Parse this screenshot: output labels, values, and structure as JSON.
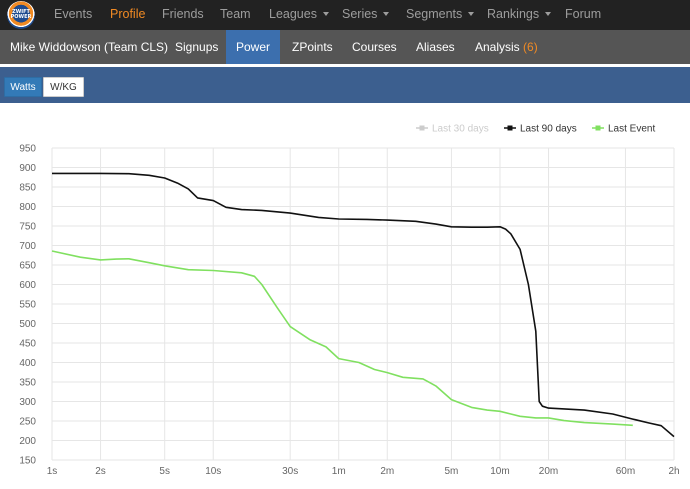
{
  "topnav": {
    "logo_text": "ZWIFT POWER",
    "items": [
      {
        "label": "Events",
        "dropdown": false
      },
      {
        "label": "Profile",
        "dropdown": false,
        "active": true
      },
      {
        "label": "Friends",
        "dropdown": false
      },
      {
        "label": "Team",
        "dropdown": false
      },
      {
        "label": "Leagues",
        "dropdown": true
      },
      {
        "label": "Series",
        "dropdown": true
      },
      {
        "label": "Segments",
        "dropdown": true
      },
      {
        "label": "Rankings",
        "dropdown": true
      },
      {
        "label": "Forum",
        "dropdown": false
      }
    ]
  },
  "subnav": {
    "profile_name": "Mike Widdowson (Team CLS)",
    "tabs": [
      {
        "label": "Signups"
      },
      {
        "label": "Power",
        "active": true
      },
      {
        "label": "ZPoints"
      },
      {
        "label": "Courses"
      },
      {
        "label": "Aliases"
      },
      {
        "label": "Analysis",
        "badge": "(6)"
      }
    ]
  },
  "power_toggle": {
    "watts": "Watts",
    "wkg": "W/KG",
    "selected": "Watts"
  },
  "chart_data": {
    "type": "line",
    "x_scale": "log",
    "x_tick_labels": [
      "1s",
      "2s",
      "5s",
      "10s",
      "30s",
      "1m",
      "2m",
      "5m",
      "10m",
      "20m",
      "60m",
      "2h"
    ],
    "x_tick_seconds": [
      1,
      2,
      5,
      10,
      30,
      60,
      120,
      300,
      600,
      1200,
      3600,
      7200
    ],
    "y_ticks": [
      150,
      200,
      250,
      300,
      350,
      400,
      450,
      500,
      550,
      600,
      650,
      700,
      750,
      800,
      850,
      900,
      950
    ],
    "ylim": [
      150,
      950
    ],
    "grid": true,
    "legend_position": "top-right",
    "series": [
      {
        "name": "Last 30 days",
        "color": "#cccccc",
        "hidden": true,
        "x": [],
        "y": []
      },
      {
        "name": "Last 90 days",
        "color": "#111111",
        "x": [
          1,
          2,
          3,
          4,
          5,
          6,
          7,
          8,
          10,
          12,
          15,
          20,
          30,
          45,
          60,
          90,
          120,
          180,
          240,
          300,
          400,
          500,
          600,
          650,
          700,
          800,
          900,
          1000,
          1050,
          1100,
          1200,
          1500,
          2000,
          3000,
          4000,
          5000,
          6000,
          7200
        ],
        "y": [
          885,
          885,
          884,
          880,
          873,
          860,
          845,
          822,
          815,
          798,
          792,
          790,
          783,
          772,
          768,
          767,
          765,
          762,
          755,
          748,
          747,
          747,
          748,
          742,
          730,
          690,
          600,
          480,
          300,
          288,
          283,
          281,
          278,
          268,
          255,
          245,
          238,
          210
        ]
      },
      {
        "name": "Last Event",
        "color": "#80e060",
        "x": [
          1,
          1.5,
          2,
          2.5,
          3,
          4,
          5,
          7,
          10,
          15,
          18,
          20,
          25,
          30,
          40,
          50,
          60,
          80,
          100,
          120,
          150,
          200,
          240,
          300,
          400,
          500,
          600,
          700,
          800,
          1000,
          1200,
          1500,
          2000,
          3000,
          4000
        ],
        "y": [
          686,
          670,
          663,
          665,
          666,
          656,
          648,
          638,
          636,
          630,
          621,
          600,
          540,
          492,
          458,
          440,
          410,
          400,
          382,
          374,
          362,
          358,
          340,
          305,
          285,
          278,
          275,
          268,
          262,
          258,
          258,
          251,
          246,
          242,
          239
        ]
      }
    ]
  }
}
